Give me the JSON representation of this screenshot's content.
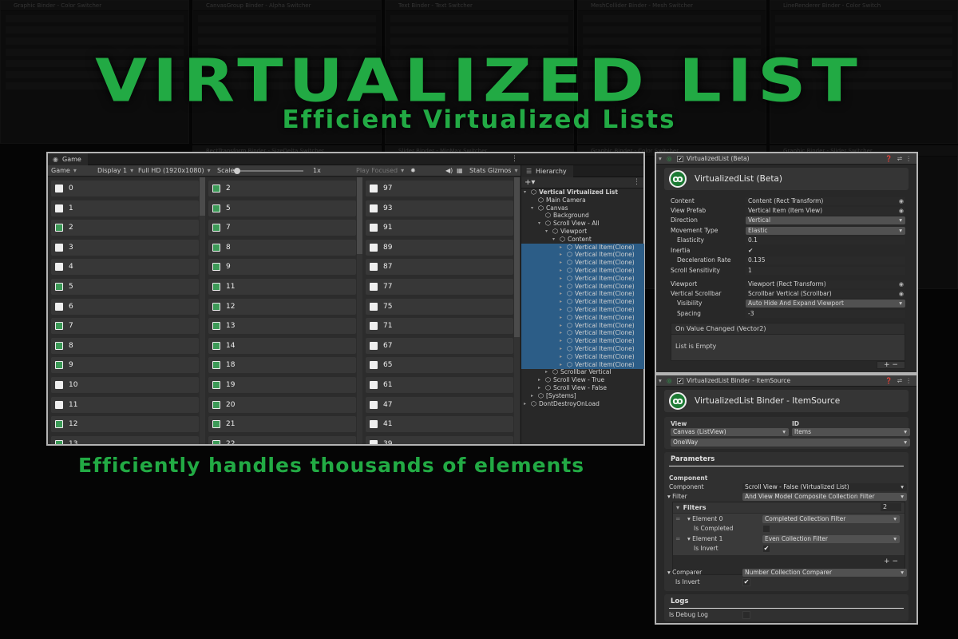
{
  "hero": {
    "title": "VIRTUALIZED LIST",
    "subtitle": "Efficient Virtualized Lists",
    "tagline": "Efficiently handles thousands of elements"
  },
  "background_tabs": [
    "Graphic Binder - Color Switcher",
    "CanvasGroup Binder - Alpha Switcher",
    "Text Binder - Text Switcher",
    "MeshCollider Binder - Mesh Switcher",
    "LineRenderer Binder - Color Switch",
    "RectTransform Binder - SizeDelta Switcher",
    "Slider Binder - MinMax Switcher",
    "Graphic Binder - Color Switcher",
    "Graphic Binder - Slider Switcher"
  ],
  "game_window": {
    "tab_label": "Game",
    "mode": "Game",
    "display": "Display 1",
    "resolution": "Full HD (1920x1080)",
    "scale_label": "Scale",
    "scale_value": "1x",
    "play_mode": "Play Focused",
    "stats": "Stats",
    "gizmos": "Gizmos",
    "columns": [
      {
        "items": [
          {
            "label": "0",
            "checked": false
          },
          {
            "label": "1",
            "checked": false
          },
          {
            "label": "2",
            "checked": true
          },
          {
            "label": "3",
            "checked": false
          },
          {
            "label": "4",
            "checked": false
          },
          {
            "label": "5",
            "checked": true
          },
          {
            "label": "6",
            "checked": false
          },
          {
            "label": "7",
            "checked": true
          },
          {
            "label": "8",
            "checked": true
          },
          {
            "label": "9",
            "checked": true
          },
          {
            "label": "10",
            "checked": false
          },
          {
            "label": "11",
            "checked": false
          },
          {
            "label": "12",
            "checked": true
          },
          {
            "label": "13",
            "checked": true
          }
        ]
      },
      {
        "items": [
          {
            "label": "2",
            "checked": true
          },
          {
            "label": "5",
            "checked": true
          },
          {
            "label": "7",
            "checked": true
          },
          {
            "label": "8",
            "checked": true
          },
          {
            "label": "9",
            "checked": true
          },
          {
            "label": "11",
            "checked": true
          },
          {
            "label": "12",
            "checked": true
          },
          {
            "label": "13",
            "checked": true
          },
          {
            "label": "14",
            "checked": true
          },
          {
            "label": "18",
            "checked": true
          },
          {
            "label": "19",
            "checked": true
          },
          {
            "label": "20",
            "checked": true
          },
          {
            "label": "21",
            "checked": true
          },
          {
            "label": "22",
            "checked": true
          }
        ]
      },
      {
        "items": [
          {
            "label": "97",
            "checked": false
          },
          {
            "label": "93",
            "checked": false
          },
          {
            "label": "91",
            "checked": false
          },
          {
            "label": "89",
            "checked": false
          },
          {
            "label": "87",
            "checked": false
          },
          {
            "label": "77",
            "checked": false
          },
          {
            "label": "75",
            "checked": false
          },
          {
            "label": "71",
            "checked": false
          },
          {
            "label": "67",
            "checked": false
          },
          {
            "label": "65",
            "checked": false
          },
          {
            "label": "61",
            "checked": false
          },
          {
            "label": "47",
            "checked": false
          },
          {
            "label": "41",
            "checked": false
          },
          {
            "label": "39",
            "checked": false
          }
        ]
      }
    ]
  },
  "hierarchy": {
    "tab_label": "Hierarchy",
    "rows": [
      {
        "label": "Vertical Virtualized List",
        "depth": 0,
        "arrow": "▾",
        "selected": false,
        "bold": true
      },
      {
        "label": "Main Camera",
        "depth": 1,
        "arrow": "",
        "selected": false,
        "bold": false
      },
      {
        "label": "Canvas",
        "depth": 1,
        "arrow": "▾",
        "selected": false,
        "bold": false
      },
      {
        "label": "Background",
        "depth": 2,
        "arrow": "",
        "selected": false,
        "bold": false
      },
      {
        "label": "Scroll View - All",
        "depth": 2,
        "arrow": "▾",
        "selected": false,
        "bold": false
      },
      {
        "label": "Viewport",
        "depth": 3,
        "arrow": "▾",
        "selected": false,
        "bold": false
      },
      {
        "label": "Content",
        "depth": 4,
        "arrow": "▾",
        "selected": false,
        "bold": false
      },
      {
        "label": "Vertical Item(Clone)",
        "depth": 5,
        "arrow": "▸",
        "selected": true,
        "bold": false
      },
      {
        "label": "Vertical Item(Clone)",
        "depth": 5,
        "arrow": "▸",
        "selected": true,
        "bold": false
      },
      {
        "label": "Vertical Item(Clone)",
        "depth": 5,
        "arrow": "▸",
        "selected": true,
        "bold": false
      },
      {
        "label": "Vertical Item(Clone)",
        "depth": 5,
        "arrow": "▸",
        "selected": true,
        "bold": false
      },
      {
        "label": "Vertical Item(Clone)",
        "depth": 5,
        "arrow": "▸",
        "selected": true,
        "bold": false
      },
      {
        "label": "Vertical Item(Clone)",
        "depth": 5,
        "arrow": "▸",
        "selected": true,
        "bold": false
      },
      {
        "label": "Vertical Item(Clone)",
        "depth": 5,
        "arrow": "▸",
        "selected": true,
        "bold": false
      },
      {
        "label": "Vertical Item(Clone)",
        "depth": 5,
        "arrow": "▸",
        "selected": true,
        "bold": false
      },
      {
        "label": "Vertical Item(Clone)",
        "depth": 5,
        "arrow": "▸",
        "selected": true,
        "bold": false
      },
      {
        "label": "Vertical Item(Clone)",
        "depth": 5,
        "arrow": "▸",
        "selected": true,
        "bold": false
      },
      {
        "label": "Vertical Item(Clone)",
        "depth": 5,
        "arrow": "▸",
        "selected": true,
        "bold": false
      },
      {
        "label": "Vertical Item(Clone)",
        "depth": 5,
        "arrow": "▸",
        "selected": true,
        "bold": false
      },
      {
        "label": "Vertical Item(Clone)",
        "depth": 5,
        "arrow": "▸",
        "selected": true,
        "bold": false
      },
      {
        "label": "Vertical Item(Clone)",
        "depth": 5,
        "arrow": "▸",
        "selected": true,
        "bold": false
      },
      {
        "label": "Vertical Item(Clone)",
        "depth": 5,
        "arrow": "▸",
        "selected": true,
        "bold": false
      },
      {
        "label": "Vertical Item(Clone)",
        "depth": 5,
        "arrow": "▸",
        "selected": true,
        "bold": false
      },
      {
        "label": "Scrollbar Vertical",
        "depth": 3,
        "arrow": "▸",
        "selected": false,
        "bold": false
      },
      {
        "label": "Scroll View - True",
        "depth": 2,
        "arrow": "▸",
        "selected": false,
        "bold": false
      },
      {
        "label": "Scroll View - False",
        "depth": 2,
        "arrow": "▸",
        "selected": false,
        "bold": false
      },
      {
        "label": "[Systems]",
        "depth": 1,
        "arrow": "▸",
        "selected": false,
        "bold": false
      },
      {
        "label": "DontDestroyOnLoad",
        "depth": 0,
        "arrow": "▸",
        "selected": false,
        "bold": false
      }
    ]
  },
  "inspector1": {
    "header": "VirtualizedList (Beta)",
    "title": "VirtualizedList (Beta)",
    "props": [
      {
        "label": "Content",
        "value": "Content (Rect Transform)",
        "kind": "obj",
        "indent": false
      },
      {
        "label": "View Prefab",
        "value": "Vertical Item (Item View)",
        "kind": "obj",
        "indent": false
      },
      {
        "label": "Direction",
        "value": "Vertical",
        "kind": "drop",
        "indent": false
      },
      {
        "label": "Movement Type",
        "value": "Elastic",
        "kind": "drop",
        "indent": false
      },
      {
        "label": "Elasticity",
        "value": "0.1",
        "kind": "field",
        "indent": true
      },
      {
        "label": "Inertia",
        "value": "✔",
        "kind": "flat",
        "indent": false
      },
      {
        "label": "Deceleration Rate",
        "value": "0.135",
        "kind": "field",
        "indent": true
      },
      {
        "label": "Scroll Sensitivity",
        "value": "1",
        "kind": "field",
        "indent": false
      },
      {
        "label": "Viewport",
        "value": "Viewport (Rect Transform)",
        "kind": "obj",
        "indent": false
      },
      {
        "label": "Vertical Scrollbar",
        "value": "Scrollbar Vertical (Scrollbar)",
        "kind": "obj",
        "indent": false
      },
      {
        "label": "Visibility",
        "value": "Auto Hide And Expand Viewport",
        "kind": "drop",
        "indent": true
      },
      {
        "label": "Spacing",
        "value": "-3",
        "kind": "field",
        "indent": true
      }
    ],
    "event_header": "On Value Changed (Vector2)",
    "event_body": "List is Empty",
    "plus_minus": "+  −"
  },
  "inspector2": {
    "header": "VirtualizedList Binder - ItemSource",
    "title": "VirtualizedList Binder - ItemSource",
    "view_label": "View",
    "id_label": "ID",
    "view_value": "Canvas (ListView)",
    "id_value": "Items",
    "binding_mode": "OneWay",
    "parameters_label": "Parameters",
    "component_section": "Component",
    "component_label": "Component",
    "component_value": "Scroll View - False (Virtualized List)",
    "filter_label": "Filter",
    "filter_value": "And View Model Composite Collection Filter",
    "filters_label": "Filters",
    "filters_count": "2",
    "element0_label": "Element 0",
    "element0_value": "Completed Collection Filter",
    "is_completed_label": "Is Completed",
    "element1_label": "Element 1",
    "element1_value": "Even Collection Filter",
    "is_invert_label": "Is Invert",
    "is_invert_value": "✔",
    "comparer_label": "Comparer",
    "comparer_value": "Number Collection Comparer",
    "comparer_invert_label": "Is Invert",
    "comparer_invert_value": "✔",
    "logs_label": "Logs",
    "debug_label": "Is Debug Log",
    "plus_minus": "+  −"
  },
  "colors": {
    "accent": "#22aa44",
    "selection": "#2c5d87",
    "checkbox_on": "#3c9a57"
  }
}
